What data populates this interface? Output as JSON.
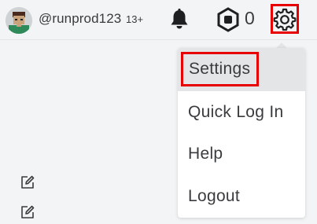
{
  "header": {
    "username": "@runprod123",
    "age_badge": "13+",
    "robux_count": "0",
    "icons": {
      "avatar": "avatar-headshot",
      "notifications": "bell-icon",
      "currency": "robux-icon",
      "settings": "gear-icon"
    }
  },
  "settings_menu": {
    "items": [
      {
        "label": "Settings",
        "highlighted": true
      },
      {
        "label": "Quick Log In",
        "highlighted": false
      },
      {
        "label": "Help",
        "highlighted": false
      },
      {
        "label": "Logout",
        "highlighted": false
      }
    ]
  },
  "sidebar": {
    "icons": [
      "edit-icon",
      "edit-icon"
    ]
  },
  "colors": {
    "highlight_border": "#e60000",
    "text": "#393b3d",
    "background": "#f2f4f5"
  }
}
